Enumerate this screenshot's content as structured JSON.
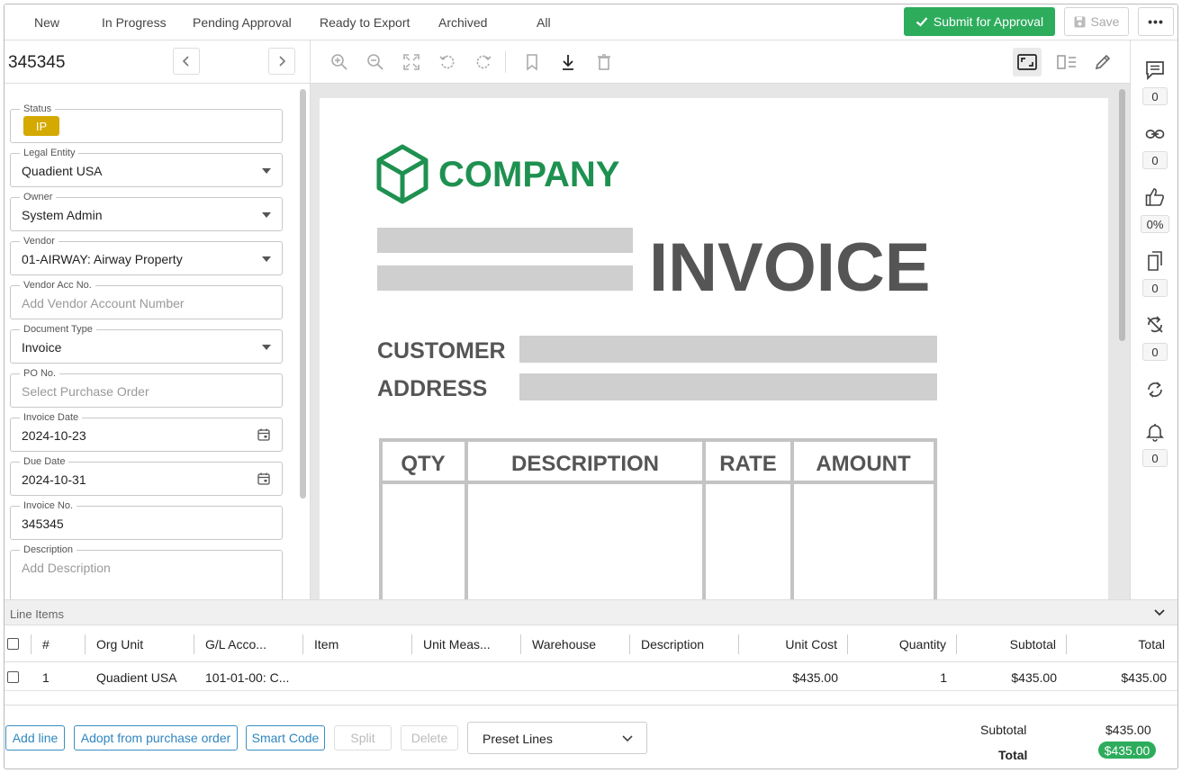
{
  "tabs": [
    {
      "label": "New"
    },
    {
      "label": "In Progress"
    },
    {
      "label": "Pending Approval"
    },
    {
      "label": "Ready to Export"
    },
    {
      "label": "Archived"
    },
    {
      "label": "All"
    }
  ],
  "actions": {
    "submit_label": "Submit for Approval",
    "save_label": "Save",
    "more_label": "•••"
  },
  "document": {
    "title": "345345"
  },
  "fields": {
    "status": {
      "label": "Status",
      "value": "IP"
    },
    "legal_entity": {
      "label": "Legal Entity",
      "value": "Quadient USA"
    },
    "owner": {
      "label": "Owner",
      "value": "System Admin"
    },
    "vendor": {
      "label": "Vendor",
      "value": "01-AIRWAY: Airway Property"
    },
    "vendor_acc": {
      "label": "Vendor Acc No.",
      "placeholder": "Add Vendor Account Number"
    },
    "document_type": {
      "label": "Document Type",
      "value": "Invoice"
    },
    "po_no": {
      "label": "PO No.",
      "placeholder": "Select Purchase Order"
    },
    "invoice_date": {
      "label": "Invoice Date",
      "value": "2024-10-23"
    },
    "due_date": {
      "label": "Due Date",
      "value": "2024-10-31"
    },
    "invoice_no": {
      "label": "Invoice No.",
      "value": "345345"
    },
    "description": {
      "label": "Description",
      "placeholder": "Add Description"
    }
  },
  "invoice_image": {
    "company": "COMPANY",
    "heading": "INVOICE",
    "customer_label": "CUSTOMER",
    "address_label": "ADDRESS",
    "columns": [
      "QTY",
      "DESCRIPTION",
      "RATE",
      "AMOUNT"
    ]
  },
  "rail_counts": {
    "comments": "0",
    "links": "0",
    "approval": "0%",
    "copies": "0",
    "sync_off": "0",
    "alerts": "0"
  },
  "line_items": {
    "title": "Line Items",
    "headers": [
      "#",
      "Org Unit",
      "G/L Acco...",
      "Item",
      "Unit Meas...",
      "Warehouse",
      "Description",
      "Unit Cost",
      "Quantity",
      "Subtotal",
      "Total"
    ],
    "rows": [
      {
        "num": "1",
        "org_unit": "Quadient USA",
        "gl": "101-01-00: C...",
        "item": "",
        "unit": "",
        "warehouse": "",
        "description": "",
        "unit_cost": "$435.00",
        "quantity": "1",
        "subtotal": "$435.00",
        "total": "$435.00"
      }
    ]
  },
  "footer": {
    "add_line": "Add line",
    "adopt_po": "Adopt from purchase order",
    "smart_code": "Smart Code",
    "split": "Split",
    "delete": "Delete",
    "preset_lines": "Preset Lines",
    "subtotal_label": "Subtotal",
    "subtotal_value": "$435.00",
    "total_label": "Total",
    "total_value": "$435.00"
  },
  "colors": {
    "accent_green": "#2dac5c",
    "status_yellow": "#d4a900",
    "link_blue": "#2f86c0",
    "logo_green": "#1e9150"
  }
}
